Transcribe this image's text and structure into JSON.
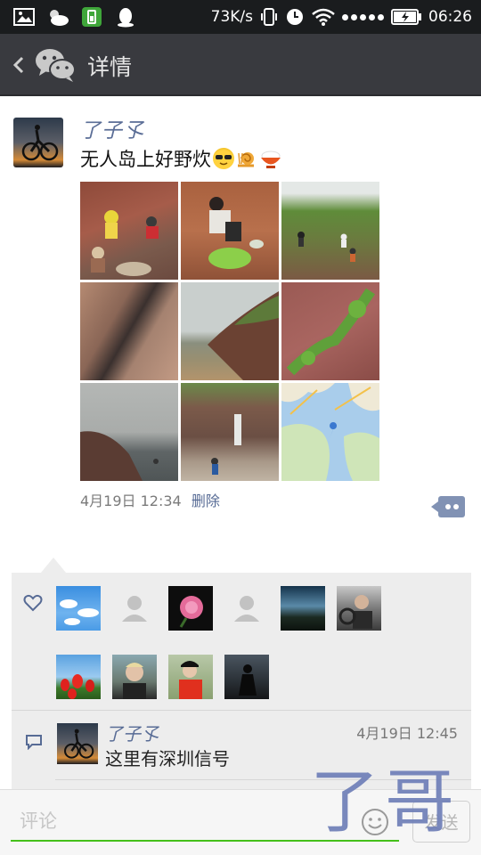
{
  "status_bar": {
    "net_speed": "73K/s",
    "time": "06:26",
    "icons": [
      "image-icon",
      "weather-icon",
      "battery-app-icon",
      "qq-icon",
      "vibrate-icon",
      "alarm-icon",
      "wifi-icon",
      "signal-icon",
      "battery-icon"
    ]
  },
  "header": {
    "title": "详情",
    "icons": [
      "back-icon",
      "wechat-icon"
    ]
  },
  "post": {
    "nickname": "了子孓",
    "text": "无人岛上好野炊",
    "emojis": [
      "sunglasses-emoji",
      "snail-emoji",
      "rice-bowl-emoji"
    ],
    "time": "4月19日 12:34",
    "delete_label": "删除",
    "photos": [
      "photo-hikers-on-red-rocks",
      "photo-picking-greens",
      "photo-grassy-hillside",
      "photo-rock-gully",
      "photo-sea-and-cliff",
      "photo-red-rock-slope",
      "photo-misty-coast",
      "photo-rocky-shore",
      "photo-map"
    ]
  },
  "likes": {
    "icon": "heart-icon",
    "avatars": [
      "avatar-blue-sky",
      "avatar-default",
      "avatar-pink-rose",
      "avatar-default",
      "avatar-dark-landscape",
      "avatar-car-driver",
      "avatar-red-tulips",
      "avatar-man-portrait",
      "avatar-woman-red-jacket",
      "avatar-dark-figure"
    ]
  },
  "comment": {
    "icon": "comment-icon",
    "name": "了子孓",
    "time": "4月19日 12:45",
    "text": "这里有深圳信号"
  },
  "input_bar": {
    "placeholder": "评论",
    "send_label": "发送"
  },
  "watermark": "了哥",
  "colors": {
    "status_bar": "#1a1c1e",
    "title_bar": "#393a3f",
    "link": "#576b95",
    "accent_green": "#45c01a",
    "panel_bg": "#ededed"
  }
}
